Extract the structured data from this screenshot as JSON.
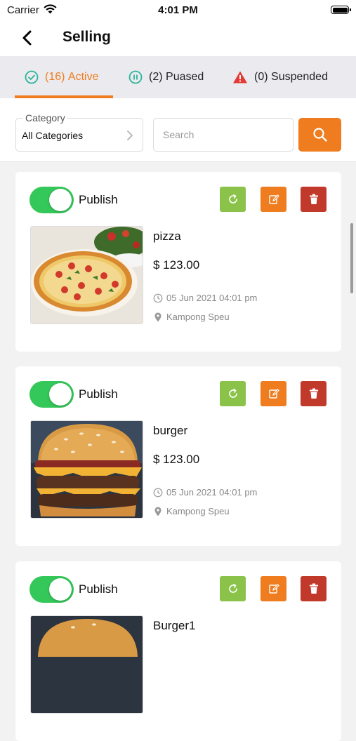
{
  "status_bar": {
    "carrier": "Carrier",
    "time": "4:01 PM"
  },
  "navbar": {
    "title": "Selling"
  },
  "tabs": [
    {
      "count": "(16)",
      "label": "Active",
      "icon": "check-circle-icon",
      "color": "#ef7c1e"
    },
    {
      "count": "(2)",
      "label": "Puased",
      "icon": "pause-circle-icon",
      "color": "#2bb39a"
    },
    {
      "count": "(0)",
      "label": "Suspended",
      "icon": "warning-triangle-icon",
      "color": "#e53935"
    }
  ],
  "filter": {
    "category_label": "Category",
    "category_value": "All Categories",
    "search_placeholder": "Search"
  },
  "colors": {
    "accent": "#ef7c1e",
    "toggle_on": "#34c759",
    "refresh": "#8bc34a",
    "delete": "#c0392b"
  },
  "products": [
    {
      "publish_label": "Publish",
      "published": true,
      "name": "pizza",
      "price": "$ 123.00",
      "date": "05 Jun 2021 04:01 pm",
      "location": "Kampong Speu"
    },
    {
      "publish_label": "Publish",
      "published": true,
      "name": "burger",
      "price": "$ 123.00",
      "date": "05 Jun 2021 04:01 pm",
      "location": "Kampong Speu"
    },
    {
      "publish_label": "Publish",
      "published": true,
      "name": "Burger1"
    }
  ]
}
